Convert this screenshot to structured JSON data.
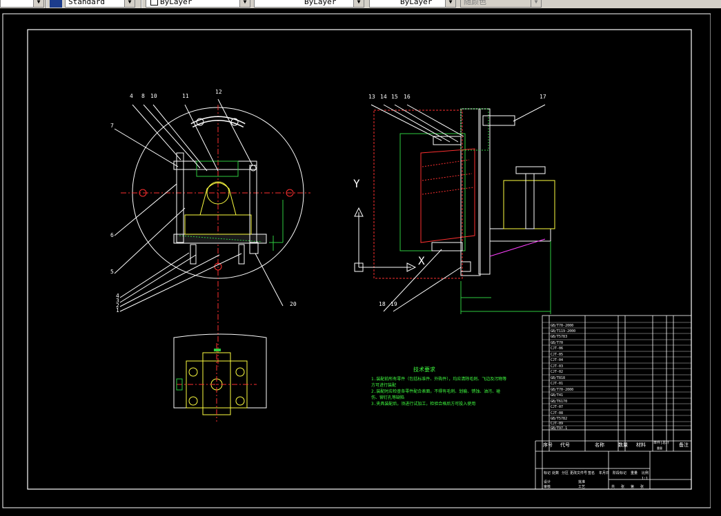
{
  "toolbar": {
    "text_style": "Standard",
    "layer": "ByLayer",
    "linetype": "ByLayer",
    "lineweight": "ByLayer",
    "plot_style": "随颜色"
  },
  "drawing": {
    "part_labels_left": [
      "4",
      "8",
      "10",
      "11",
      "12",
      "7",
      "6",
      "5",
      "4",
      "3",
      "2",
      "1",
      "20"
    ],
    "part_labels_right": [
      "13",
      "14",
      "15",
      "16",
      "17",
      "18",
      "19"
    ],
    "ucs_y": "Y",
    "ucs_x": "X",
    "tech_title": "技术要求",
    "tech_lines": [
      "1.装配前所有零件（包括标准件、外购件），均应清除毛刺、飞边及污物等",
      "方可进行装配",
      "2.装配时应检查各零件配合表面，不得有毛刺、划痕、锈蚀、油污、碰",
      "伤、铆钉孔等缺陷",
      "3.夹具装配后，须进行试加工，检验合格后方可投入使用"
    ]
  },
  "title_block": {
    "header": [
      "序号",
      "代号",
      "名称",
      "数量",
      "材料",
      "单件|总计",
      "备注"
    ],
    "weight_label": "重量",
    "rows": [
      "GB/T70-2000",
      "GB/T119-2000",
      "GB/T5783",
      "GB/T70",
      "CJT-06",
      "CJT-05",
      "CJT-04",
      "CJT-03",
      "CJT-02",
      "GB/T818",
      "CJT-01",
      "GB/T70-2000",
      "GB/T41",
      "GB/T6170",
      "CJT-07",
      "CJT-08",
      "GB/T5782",
      "CJT-09",
      "GB/T97.1"
    ],
    "bottom_labels": [
      "标记",
      "处数",
      "分区",
      "更改文件号",
      "签名",
      "年月日"
    ],
    "design_label": "设计",
    "audit_label": "审核",
    "process_label": "工艺",
    "approve_label": "批准",
    "stage_label": "阶段标记",
    "weight_col": "重量",
    "ratio_col": "比例",
    "ratio_val": "1:1",
    "sheet_labels": [
      "共",
      "张",
      "第",
      "张"
    ]
  }
}
